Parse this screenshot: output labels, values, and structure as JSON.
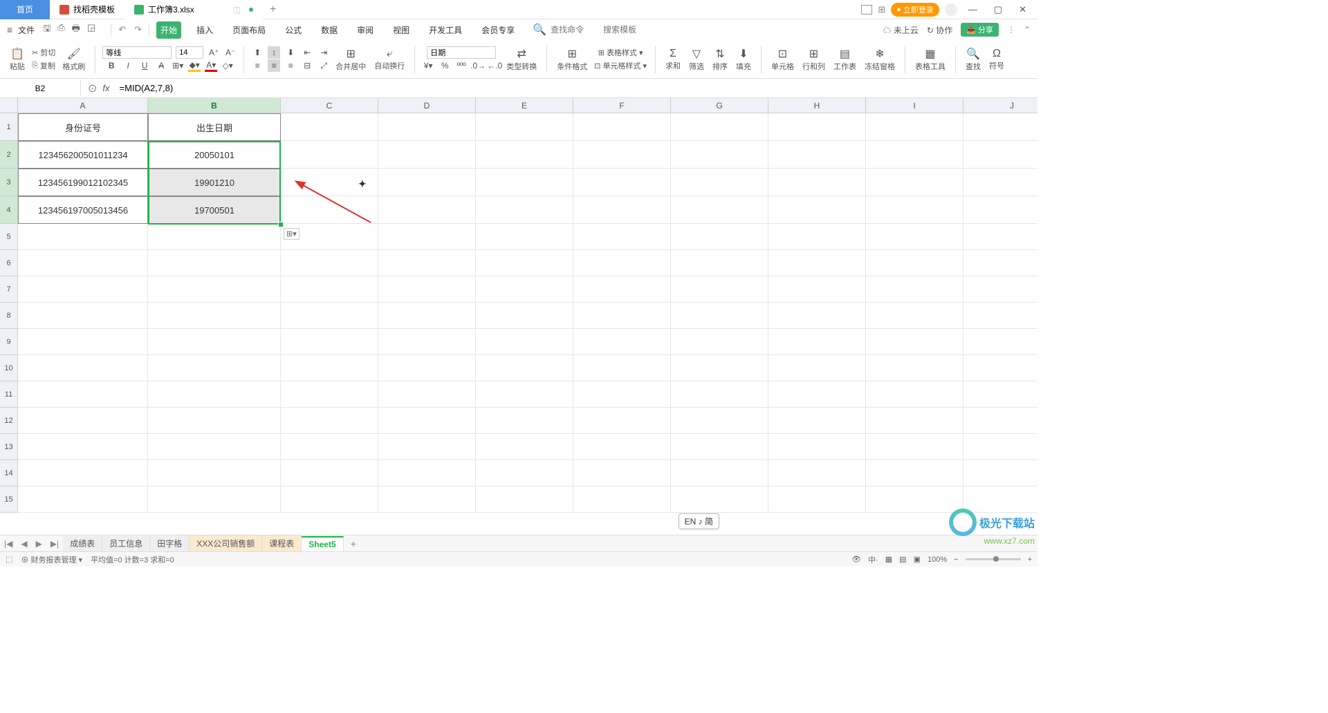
{
  "titlebar": {
    "home": "首页",
    "tabs": [
      {
        "icon": "d",
        "label": "找稻壳模板"
      },
      {
        "icon": "x",
        "label": "工作簿3.xlsx",
        "active": true
      }
    ],
    "login": "立即登录"
  },
  "menubar": {
    "file": "文件",
    "tabs": [
      "开始",
      "插入",
      "页面布局",
      "公式",
      "数据",
      "审阅",
      "视图",
      "开发工具",
      "会员专享"
    ],
    "active": 0,
    "search_placeholder": "查找命令",
    "search_tpl": "搜索模板",
    "cloud": "未上云",
    "collab": "协作",
    "share": "分享"
  },
  "ribbon": {
    "paste": "粘贴",
    "cut": "剪切",
    "copy": "复制",
    "brush": "格式刷",
    "font": "等线",
    "size": "14",
    "merge": "合并居中",
    "wrap": "自动换行",
    "numfmt": "日期",
    "convert": "类型转换",
    "condfmt": "条件格式",
    "tablestyle": "表格样式",
    "cellstyle": "单元格样式",
    "sum": "求和",
    "filter": "筛选",
    "sort": "排序",
    "fill": "填充",
    "cell": "单元格",
    "rowcol": "行和列",
    "sheet": "工作表",
    "freeze": "冻结窗格",
    "tabletool": "表格工具",
    "find": "查找",
    "symbol": "符号"
  },
  "formulabar": {
    "namebox": "B2",
    "formula": "=MID(A2,7,8)"
  },
  "columns": [
    "A",
    "B",
    "C",
    "D",
    "E",
    "F",
    "G",
    "H",
    "I",
    "J"
  ],
  "rows": [
    1,
    2,
    3,
    4,
    5,
    6,
    7,
    8,
    9,
    10,
    11,
    12,
    13,
    14,
    15
  ],
  "headers": {
    "A": "身份证号",
    "B": "出生日期"
  },
  "data": {
    "r2": {
      "A": "123456200501011234",
      "B": "20050101"
    },
    "r3": {
      "A": "123456199012102345",
      "B": "19901210"
    },
    "r4": {
      "A": "123456197005013456",
      "B": "19700501"
    }
  },
  "selection": {
    "col": "B",
    "rows": [
      2,
      3,
      4
    ]
  },
  "ime": "EN ♪ 简",
  "sheets": [
    "成绩表",
    "员工信息",
    "田字格",
    "XXX公司销售额",
    "课程表",
    "Sheet5"
  ],
  "activeSheet": 5,
  "highlightSheets": [
    3,
    4
  ],
  "statusbar": {
    "mgmt": "财务报表管理",
    "stats": "平均值=0  计数=3  求和=0",
    "zoom": "100%"
  },
  "watermark": {
    "t1": "极光下载站",
    "t2": "www.xz7.com"
  }
}
